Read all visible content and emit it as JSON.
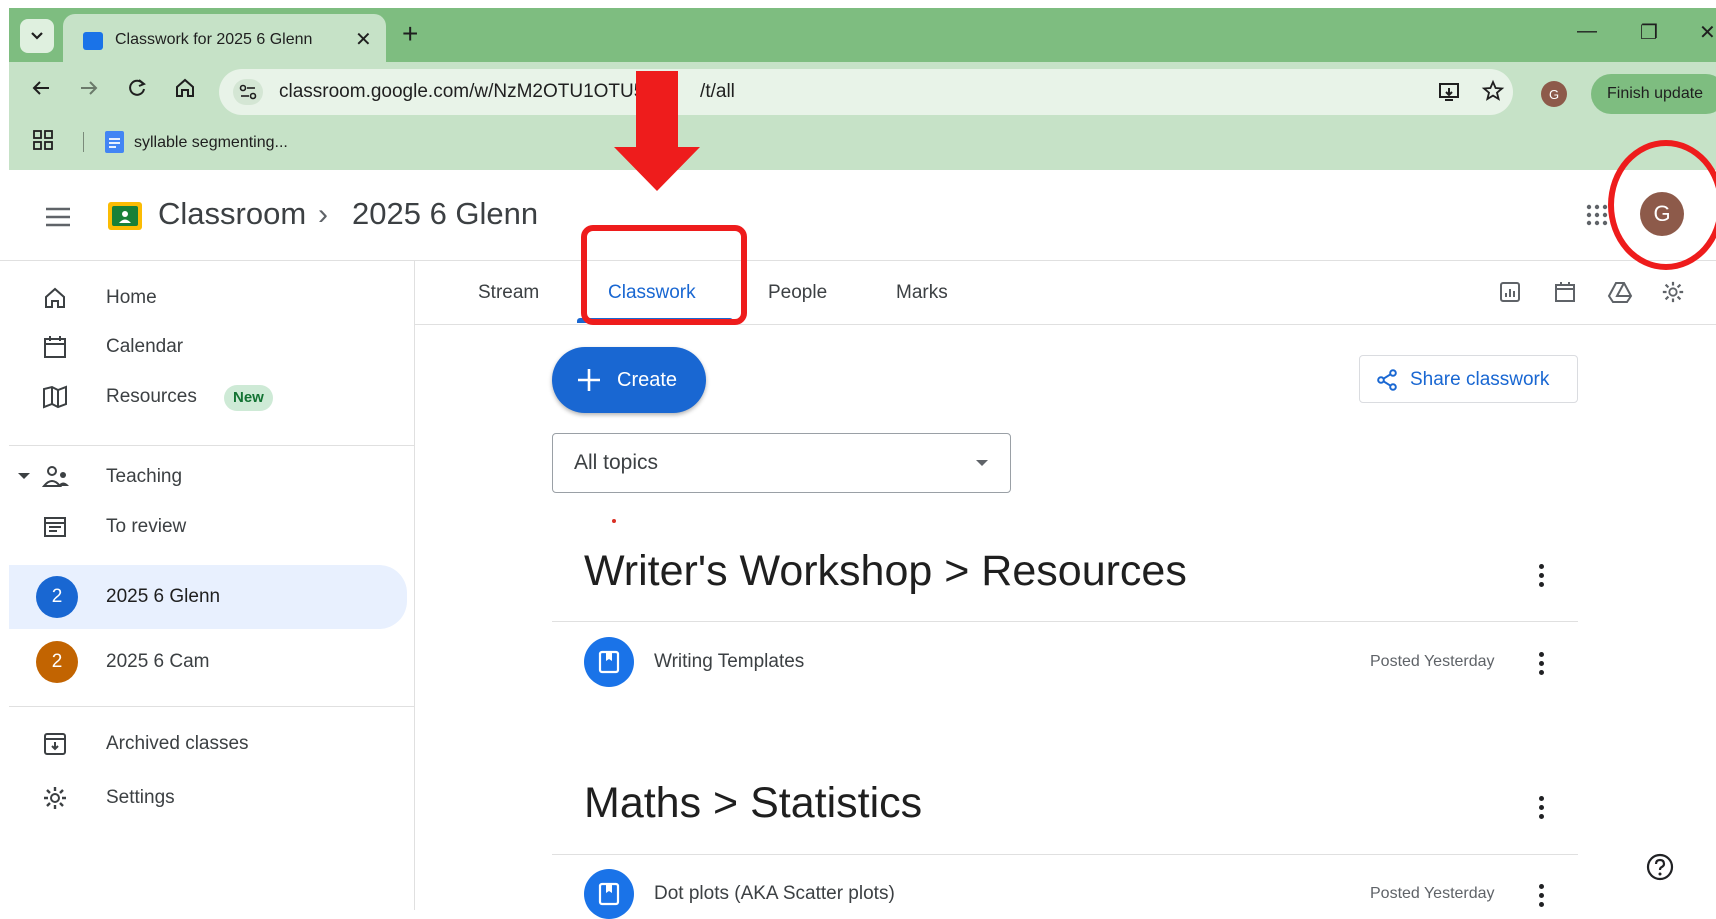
{
  "browser": {
    "tab_title": "Classwork for 2025 6 Glenn",
    "url": "classroom.google.com/w/NzM2OTU1OTU5N",
    "url_tail": "/t/all",
    "bookmark_label": "syllable segmenting...",
    "profile_initial": "G",
    "finish_update_label": "Finish update"
  },
  "header": {
    "brand": "Classroom",
    "breadcrumb_sep": "›",
    "class_name": "2025 6 Glenn",
    "avatar_initial": "G"
  },
  "sidebar": {
    "items": [
      {
        "label": "Home",
        "icon": "home-icon"
      },
      {
        "label": "Calendar",
        "icon": "calendar-icon"
      },
      {
        "label": "Resources",
        "icon": "resources-icon",
        "badge": "New"
      },
      {
        "label": "Teaching",
        "icon": "teaching-icon"
      },
      {
        "label": "To review",
        "icon": "to-review-icon"
      },
      {
        "label": "2025 6 Glenn",
        "initial": "2",
        "color": "#1967d2",
        "active": true
      },
      {
        "label": "2025 6 Cam",
        "initial": "2",
        "color": "#c26401"
      },
      {
        "label": "Archived classes",
        "icon": "archive-icon"
      },
      {
        "label": "Settings",
        "icon": "settings-icon"
      }
    ]
  },
  "tabs": [
    {
      "label": "Stream"
    },
    {
      "label": "Classwork",
      "active": true
    },
    {
      "label": "People"
    },
    {
      "label": "Marks"
    }
  ],
  "main": {
    "create_label": "Create",
    "share_label": "Share classwork",
    "topic_filter": "All topics",
    "topics": [
      {
        "title": "Writer's Workshop > Resources",
        "items": [
          {
            "title": "Writing Templates",
            "posted": "Posted Yesterday"
          }
        ]
      },
      {
        "title": "Maths > Statistics",
        "items": [
          {
            "title": "Dot plots (AKA Scatter plots)",
            "posted": "Posted Yesterday"
          }
        ]
      }
    ]
  },
  "colors": {
    "accent": "#1967d2",
    "annotation_red": "#ee1c1c",
    "chrome_green": "#7ebd80"
  }
}
